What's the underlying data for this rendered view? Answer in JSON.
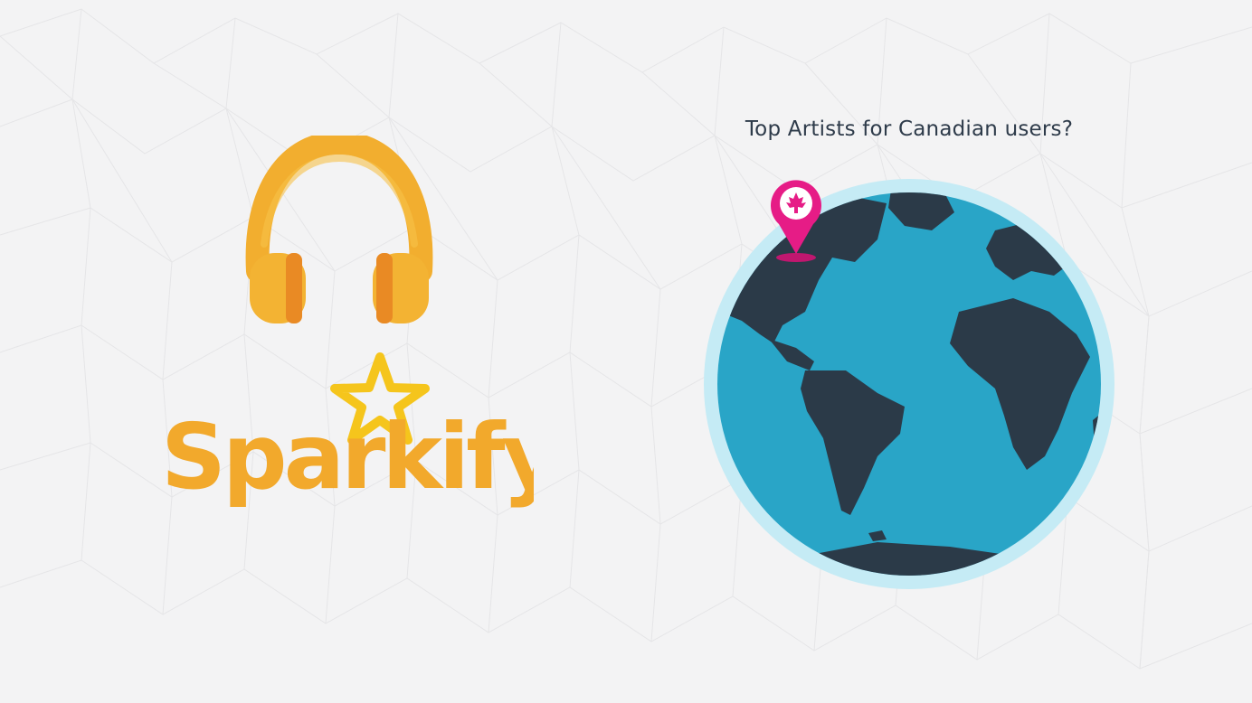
{
  "brand": {
    "name": "Sparkify",
    "primary_color": "#f2a92c",
    "dark_color": "#e8932b",
    "accent_color": "#ef8b1f"
  },
  "question": {
    "text": "Top Artists for Canadian users?"
  },
  "globe": {
    "ocean_color": "#29a5c7",
    "land_color": "#2b3a48",
    "rim_color": "#bfe9f4"
  },
  "pin": {
    "color": "#e61c86",
    "icon": "maple-leaf-icon"
  },
  "icons": {
    "headphones": "headphones-icon",
    "star": "star-icon"
  }
}
